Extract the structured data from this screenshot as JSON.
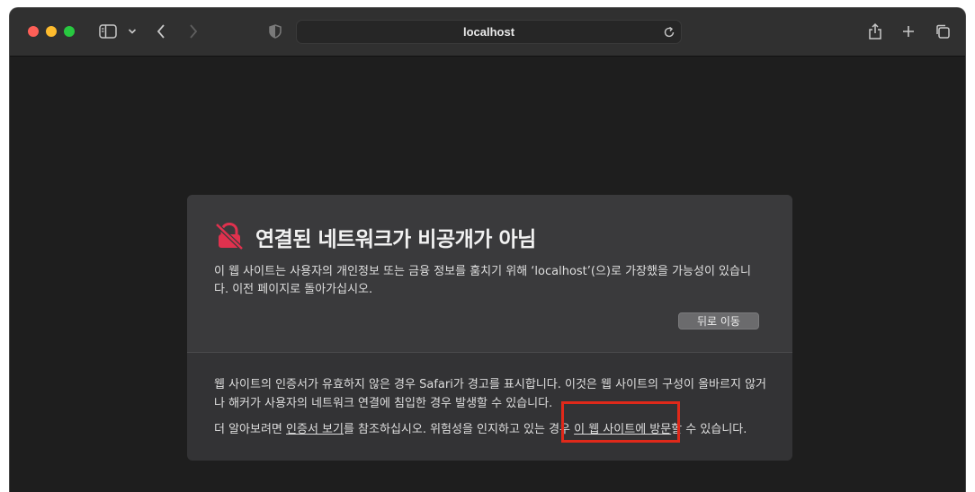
{
  "browser": {
    "url": "localhost",
    "icons": [
      "sidebar-icon",
      "chevron-down-icon",
      "back-icon",
      "forward-icon",
      "shield-icon",
      "reload-icon",
      "share-icon",
      "new-tab-icon",
      "tabs-overview-icon"
    ]
  },
  "warning": {
    "title": "연결된 네트워크가 비공개가 아님",
    "description": "이 웹 사이트는 사용자의 개인정보 또는 금융 정보를 훔치기 위해 ‘localhost’(으)로 가장했을 가능성이 있습니다. 이전 페이지로 돌아가십시오.",
    "back_button": "뒤로 이동",
    "details": "웹 사이트의 인증서가 유효하지 않은 경우 Safari가 경고를 표시합니다. 이것은 웹 사이트의 구성이 올바르지 않거나 해커가 사용자의 네트워크 연결에 침입한 경우 발생할 수 있습니다.",
    "more_prefix": "더 알아보려면 ",
    "view_certificate_link": "인증서 보기",
    "more_middle": "를 참조하십시오. 위험성을 인지하고 있는 경우 ",
    "visit_link": "이 웹 사이트에 방문",
    "more_suffix": "할 수 있습니다."
  },
  "colors": {
    "warning_icon": "#e0314e",
    "highlight_box": "#e0291a"
  }
}
